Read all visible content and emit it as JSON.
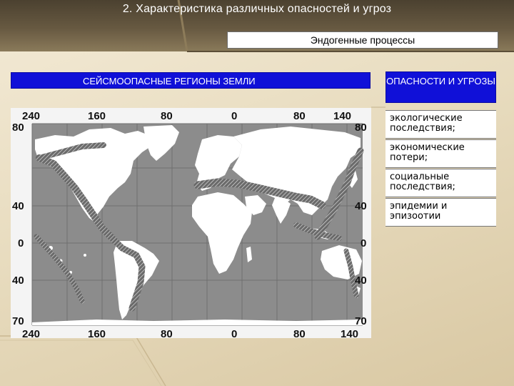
{
  "slide": {
    "title": "2. Характеристика различных опасностей и угроз",
    "section": "Эндогенные процессы"
  },
  "map": {
    "header": "СЕЙСМООПАСНЫЕ РЕГИОНЫ ЗЕМЛИ",
    "top_axis": [
      "240",
      "160",
      "80",
      "0",
      "80",
      "140"
    ],
    "bottom_axis": [
      "240",
      "160",
      "80",
      "0",
      "80",
      "140"
    ],
    "left_axis": [
      "80",
      "40",
      "0",
      "40",
      "70"
    ],
    "right_axis": [
      "80",
      "40",
      "0",
      "40",
      "70"
    ],
    "colors": {
      "ocean": "#8c8c8c",
      "land": "#ffffff",
      "seismic_belt": "#444444"
    }
  },
  "threats": {
    "header": "ОПАСНОСТИ И УГРОЗЫ",
    "items": [
      "экологические последствия;",
      "экономические потери;",
      "социальные последствия;",
      "эпидемии и эпизоотии"
    ]
  }
}
